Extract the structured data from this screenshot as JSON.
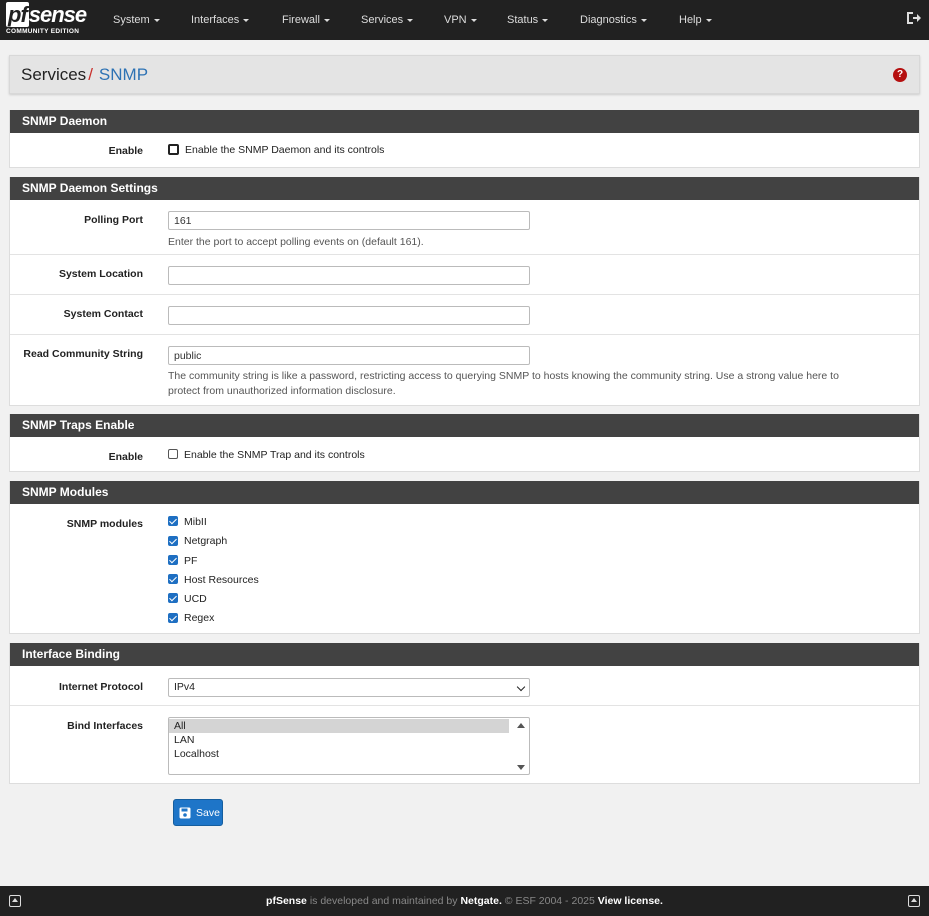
{
  "brand": {
    "logo_main": "sense",
    "logo_pf": "pf",
    "logo_sub": "COMMUNITY EDITION"
  },
  "nav": [
    {
      "label": "System"
    },
    {
      "label": "Interfaces"
    },
    {
      "label": "Firewall"
    },
    {
      "label": "Services"
    },
    {
      "label": "VPN"
    },
    {
      "label": "Status"
    },
    {
      "label": "Diagnostics"
    },
    {
      "label": "Help"
    }
  ],
  "breadcrumb": {
    "parent": "Services",
    "separator": "/",
    "current": "SNMP"
  },
  "help_icon": "question-circle-icon",
  "snmp_daemon": {
    "heading": "SNMP Daemon",
    "enable_label": "Enable",
    "enable_text": "Enable the SNMP Daemon and its controls",
    "enable_checked": false
  },
  "settings": {
    "heading": "SNMP Daemon Settings",
    "polling_port_label": "Polling Port",
    "polling_port_value": "161",
    "polling_port_help": "Enter the port to accept polling events on (default 161).",
    "system_location_label": "System Location",
    "system_location_value": "",
    "system_contact_label": "System Contact",
    "system_contact_value": "",
    "community_label": "Read Community String",
    "community_value": "public",
    "community_help_1": "The community string is like a password, restricting access to querying SNMP to hosts knowing the community string. Use a strong value here to",
    "community_help_2": "protect from unauthorized information disclosure."
  },
  "traps": {
    "heading": "SNMP Traps Enable",
    "enable_label": "Enable",
    "enable_text": "Enable the SNMP Trap and its controls",
    "enable_checked": false
  },
  "modules": {
    "heading": "SNMP Modules",
    "label": "SNMP modules",
    "items": [
      {
        "label": "MibII",
        "checked": true
      },
      {
        "label": "Netgraph",
        "checked": true
      },
      {
        "label": "PF",
        "checked": true
      },
      {
        "label": "Host Resources",
        "checked": true
      },
      {
        "label": "UCD",
        "checked": true
      },
      {
        "label": "Regex",
        "checked": true
      }
    ]
  },
  "binding": {
    "heading": "Interface Binding",
    "protocol_label": "Internet Protocol",
    "protocol_value": "IPv4",
    "bind_label": "Bind Interfaces",
    "bind_options": [
      {
        "label": "All",
        "selected": true
      },
      {
        "label": "LAN",
        "selected": false
      },
      {
        "label": "Localhost",
        "selected": false
      }
    ]
  },
  "save_label": "Save",
  "footer": {
    "brand": "pfSense",
    "text1": " is developed and maintained by ",
    "company": "Netgate.",
    "text2": " © ESF 2004 - 2025 ",
    "license": "View license."
  }
}
